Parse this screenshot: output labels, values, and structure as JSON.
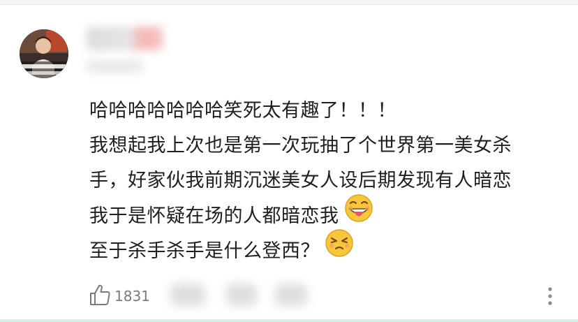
{
  "comment": {
    "lines": [
      "哈哈哈哈哈哈哈笑死太有趣了！！！",
      "我想起我上次也是第一次玩抽了个世界第一美女杀",
      "手，好家伙我前期沉迷美女人设后期发现有人暗恋",
      "我于是怀疑在场的人都暗恋我",
      "至于杀手杀手是什么登西？"
    ],
    "emojis": [
      "grinning-tongue-emoji",
      "squinting-pout-emoji"
    ]
  },
  "actions": {
    "like_count": "1831",
    "like_icon": "thumbs-up-icon",
    "more_icon": "more-vertical-icon"
  },
  "colors": {
    "text": "#1f1f1f",
    "muted": "#7a7a7a",
    "emoji_yellow": "#f8c63a"
  }
}
